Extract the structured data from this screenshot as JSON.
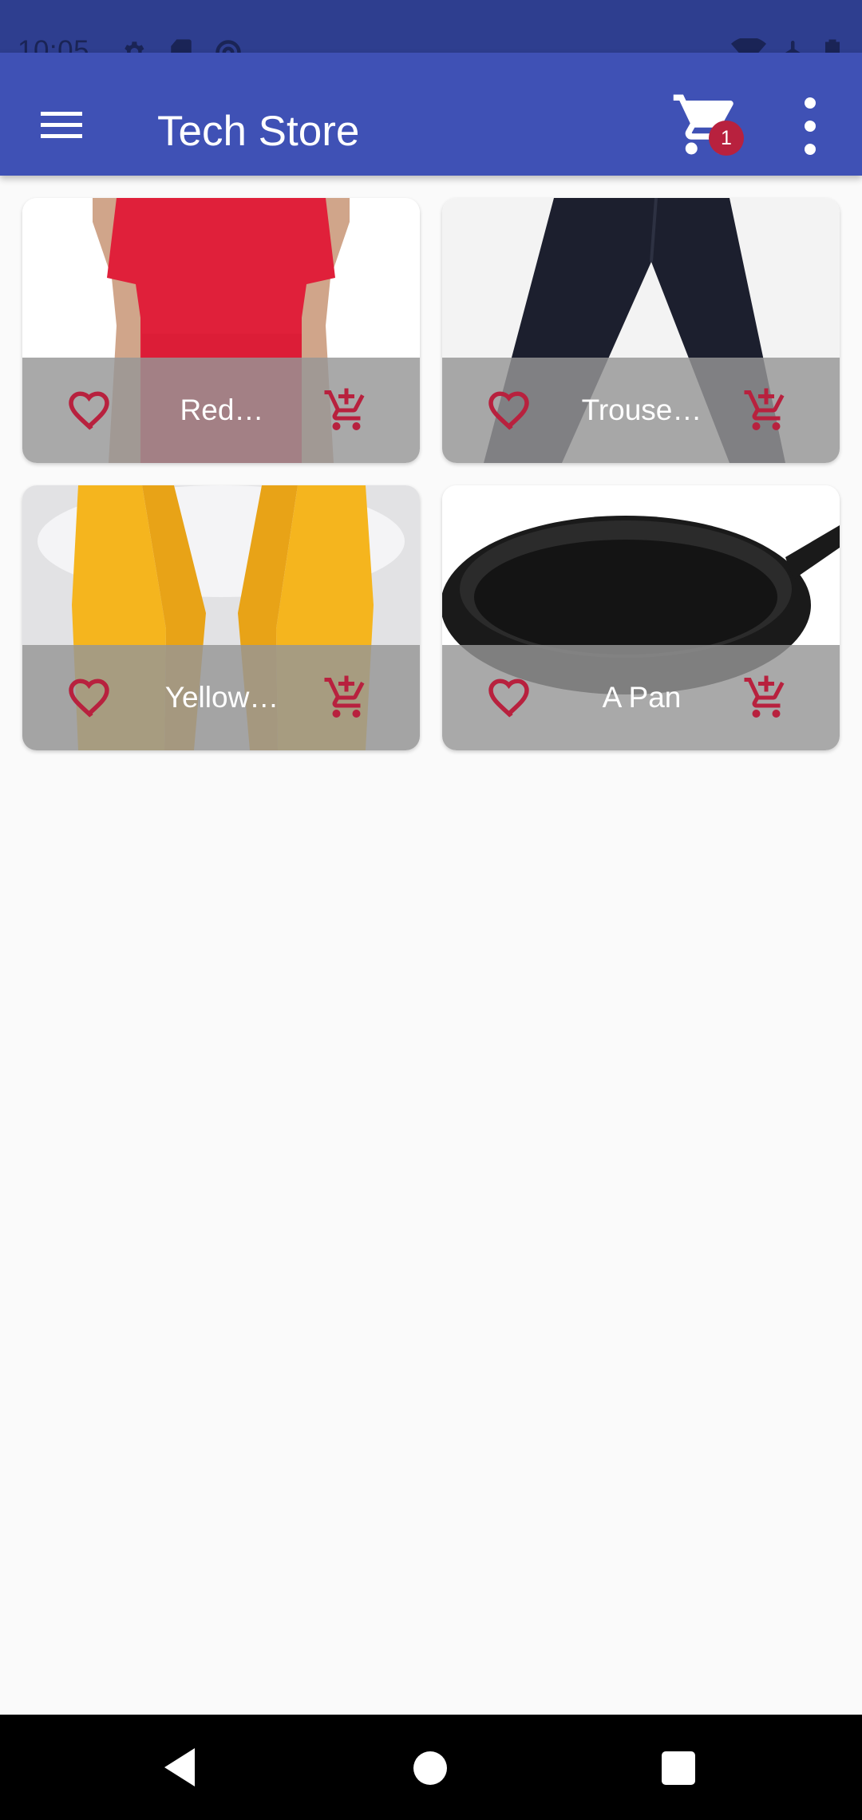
{
  "status_bar": {
    "time": "10:05",
    "left_icons": [
      "gear-icon",
      "sd-card-icon",
      "at-sign-icon"
    ],
    "right_icons": [
      "wifi-icon",
      "airplane-icon",
      "battery-icon"
    ]
  },
  "app_bar": {
    "title": "Tech Store",
    "menu_icon": "menu-icon",
    "cart_icon": "shopping-cart-icon",
    "cart_badge": "1",
    "overflow_icon": "more-vert-icon"
  },
  "products": [
    {
      "name": "Red…",
      "image": "red-tshirt",
      "fav_icon": "heart-outline-icon",
      "cart_icon": "add-shopping-cart-icon"
    },
    {
      "name": "Trouse…",
      "image": "black-trousers",
      "fav_icon": "heart-outline-icon",
      "cart_icon": "add-shopping-cart-icon"
    },
    {
      "name": "Yellow…",
      "image": "yellow-scarf",
      "fav_icon": "heart-outline-icon",
      "cart_icon": "add-shopping-cart-icon"
    },
    {
      "name": "A Pan",
      "image": "cast-iron-pan",
      "fav_icon": "heart-outline-icon",
      "cart_icon": "add-shopping-cart-icon"
    }
  ],
  "nav_bar": {
    "back": "back-icon",
    "home": "home-icon",
    "recents": "recents-icon"
  },
  "colors": {
    "primary": "#3f51b5",
    "status_bar": "#2e3e8f",
    "accent": "#b8213e",
    "background": "#fafafa"
  }
}
